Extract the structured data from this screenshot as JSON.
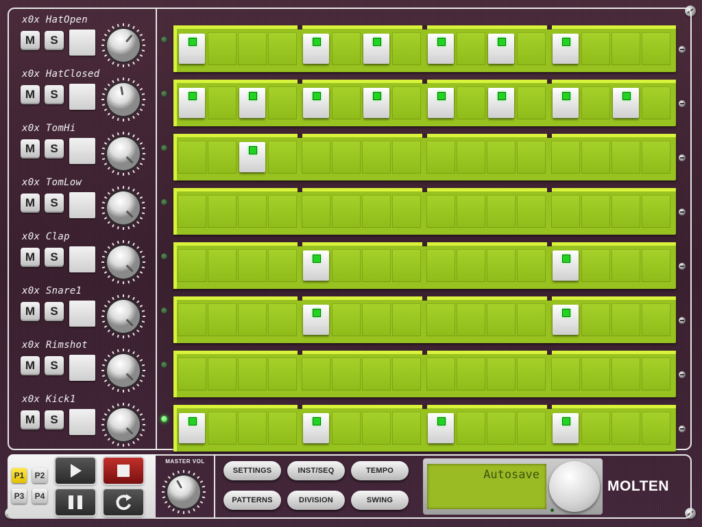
{
  "tracks": [
    {
      "name": "x0x HatOpen",
      "mute": "M",
      "solo": "S",
      "led_on": false,
      "steps": [
        1,
        0,
        0,
        0,
        1,
        0,
        1,
        0,
        1,
        0,
        1,
        0,
        1,
        0,
        0,
        0
      ]
    },
    {
      "name": "x0x HatClosed",
      "mute": "M",
      "solo": "S",
      "led_on": false,
      "steps": [
        1,
        0,
        1,
        0,
        1,
        0,
        1,
        0,
        1,
        0,
        1,
        0,
        1,
        0,
        1,
        0
      ]
    },
    {
      "name": "x0x TomHi",
      "mute": "M",
      "solo": "S",
      "led_on": false,
      "steps": [
        0,
        0,
        1,
        0,
        0,
        0,
        0,
        0,
        0,
        0,
        0,
        0,
        0,
        0,
        0,
        0
      ]
    },
    {
      "name": "x0x TomLow",
      "mute": "M",
      "solo": "S",
      "led_on": false,
      "steps": [
        0,
        0,
        0,
        0,
        0,
        0,
        0,
        0,
        0,
        0,
        0,
        0,
        0,
        0,
        0,
        0
      ]
    },
    {
      "name": "x0x Clap",
      "mute": "M",
      "solo": "S",
      "led_on": false,
      "steps": [
        0,
        0,
        0,
        0,
        1,
        0,
        0,
        0,
        0,
        0,
        0,
        0,
        1,
        0,
        0,
        0
      ]
    },
    {
      "name": "x0x Snare1",
      "mute": "M",
      "solo": "S",
      "led_on": false,
      "steps": [
        0,
        0,
        0,
        0,
        1,
        0,
        0,
        0,
        0,
        0,
        0,
        0,
        1,
        0,
        0,
        0
      ]
    },
    {
      "name": "x0x Rimshot",
      "mute": "M",
      "solo": "S",
      "led_on": false,
      "steps": [
        0,
        0,
        0,
        0,
        0,
        0,
        0,
        0,
        0,
        0,
        0,
        0,
        0,
        0,
        0,
        0
      ]
    },
    {
      "name": "x0x Kick1",
      "mute": "M",
      "solo": "S",
      "led_on": true,
      "steps": [
        1,
        0,
        0,
        0,
        1,
        0,
        0,
        0,
        1,
        0,
        0,
        0,
        1,
        0,
        0,
        0
      ]
    }
  ],
  "transport": {
    "patterns": [
      "P1",
      "P2",
      "P3",
      "P4"
    ],
    "active_pattern": "P1",
    "buttons": [
      "play-icon",
      "stop-icon",
      "pause-icon",
      "loop-icon"
    ]
  },
  "master": {
    "label": "MASTER VOL"
  },
  "function_buttons": {
    "settings": "SETTINGS",
    "inst_seq": "INST/SEQ",
    "tempo": "TEMPO",
    "patterns": "PATTERNS",
    "division": "DIVISION",
    "swing": "SWING"
  },
  "display": {
    "text": "Autosave"
  },
  "brand": "MOLTEN",
  "colors": {
    "step_green": "#98c21f",
    "led_green": "#22d422",
    "panel": "#3a1f2e",
    "stop_red": "#c0302b"
  }
}
